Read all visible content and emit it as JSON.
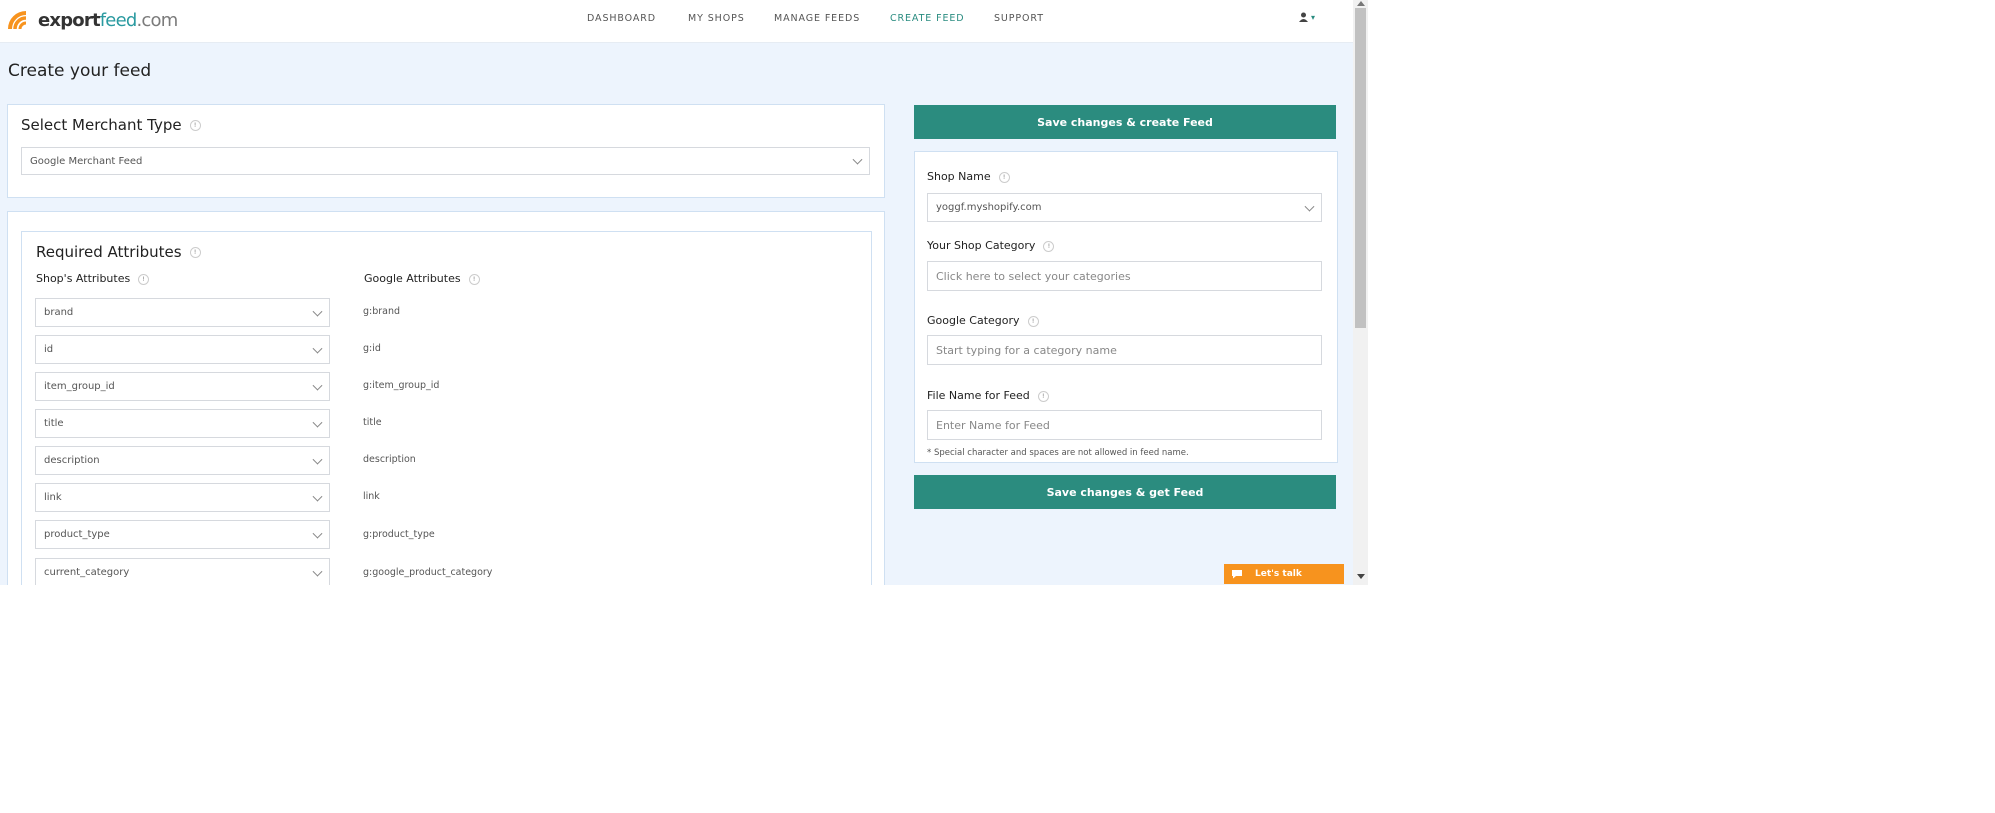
{
  "brand": {
    "part1": "export",
    "part2": "feed",
    "part3": ".com"
  },
  "nav": [
    {
      "label": "DASHBOARD"
    },
    {
      "label": "MY SHOPS"
    },
    {
      "label": "MANAGE FEEDS"
    },
    {
      "label": "CREATE FEED",
      "active": true
    },
    {
      "label": "SUPPORT"
    }
  ],
  "user_menu": {
    "icon": "user-icon",
    "caret": "▾"
  },
  "page_title": "Create your feed",
  "merchant": {
    "title": "Select Merchant Type",
    "info": "!",
    "selected": "Google Merchant Feed"
  },
  "required": {
    "title": "Required Attributes",
    "info": "!",
    "shop_col": "Shop's Attributes",
    "google_col": "Google Attributes",
    "rows": [
      {
        "shop": "brand",
        "google": "g:brand"
      },
      {
        "shop": "id",
        "google": "g:id"
      },
      {
        "shop": "item_group_id",
        "google": "g:item_group_id"
      },
      {
        "shop": "title",
        "google": "title"
      },
      {
        "shop": "description",
        "google": "description"
      },
      {
        "shop": "link",
        "google": "link"
      },
      {
        "shop": "product_type",
        "google": "g:product_type"
      },
      {
        "shop": "current_category",
        "google": "g:google_product_category"
      }
    ]
  },
  "side": {
    "btn_create": "Save changes & create Feed",
    "shop_name_label": "Shop Name",
    "shop_name_value": "yoggf.myshopify.com",
    "shop_category_label": "Your Shop Category",
    "shop_category_placeholder": "Click here to select your categories",
    "google_category_label": "Google Category",
    "google_category_placeholder": "Start typing for a category name",
    "filename_label": "File Name for Feed",
    "filename_placeholder": "Enter Name for Feed",
    "note": "* Special character and spaces are not allowed in feed name.",
    "btn_get": "Save changes & get Feed"
  },
  "chat": {
    "label": "Let's talk",
    "icon": "chat-bubble-icon"
  },
  "colors": {
    "accent": "#2b8c7f",
    "bg": "#edf4fd",
    "chat": "#f7931e",
    "logo_orange": "#f7931e",
    "logo_teal": "#2a9aa0"
  }
}
